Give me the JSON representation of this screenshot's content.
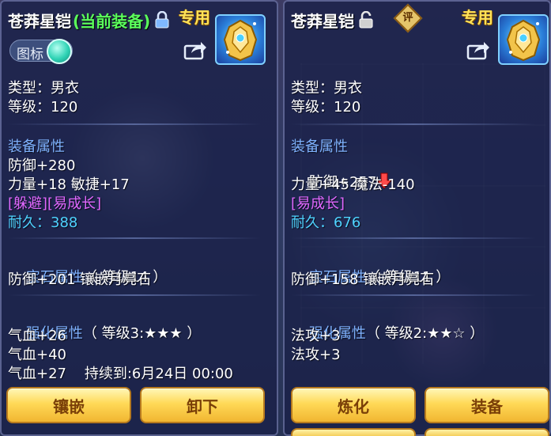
{
  "left": {
    "item_name": "苍莽星铠",
    "equipped_note": "(当前装备)",
    "exclusive_tag": "专用",
    "toggle_label": "图标",
    "type": "类型：男衣",
    "level": "等级：120",
    "equip_attr_title": "装备属性",
    "defense": "防御+280",
    "stats": "力量+18 敏捷+17",
    "special_effect": "[躲避][易成长]",
    "durability": "耐久：388",
    "gem_title": "宝石属性",
    "gem_level": "（ 等级14 ）",
    "gem_effect": "防御+201 镶嵌月亮石",
    "enhance_title": "强化属性",
    "enhance_level": "（ 等级3:★★★ ）",
    "enhance_lines": [
      "气血+26",
      "气血+40",
      "气血+27    持续到:6月24日 00:00"
    ],
    "buttons": [
      "镶嵌",
      "卸下"
    ]
  },
  "right": {
    "item_name": "苍莽星铠",
    "rate_badge": "评",
    "exclusive_tag": "专用",
    "type": "类型：男衣",
    "level": "等级：120",
    "equip_attr_title": "装备属性",
    "defense": "防御+257",
    "stats": "力量+45 魔法-140",
    "special_effect": "[易成长]",
    "durability": "耐久：676",
    "gem_title": "宝石属性",
    "gem_level": "（ 等级11 ）",
    "gem_effect": "防御+158 镶嵌月亮石",
    "enhance_title": "强化属性",
    "enhance_level": "（ 等级2:★★☆ ）",
    "enhance_lines": [
      "法攻+3",
      "法攻+3"
    ],
    "buttons": [
      "炼化",
      "装备"
    ]
  },
  "icons": [
    "lock-closed-icon",
    "lock-open-icon",
    "share-icon",
    "armor-icon",
    "down-arrow-icon"
  ],
  "colors": {
    "section_title": "#7fb2ff",
    "special_effect": "#e068ff",
    "durability": "#4fd2ff",
    "equipped_note": "#5bff5b",
    "exclusive_tag": "#ffe35a",
    "button_text": "#7a3f08"
  }
}
